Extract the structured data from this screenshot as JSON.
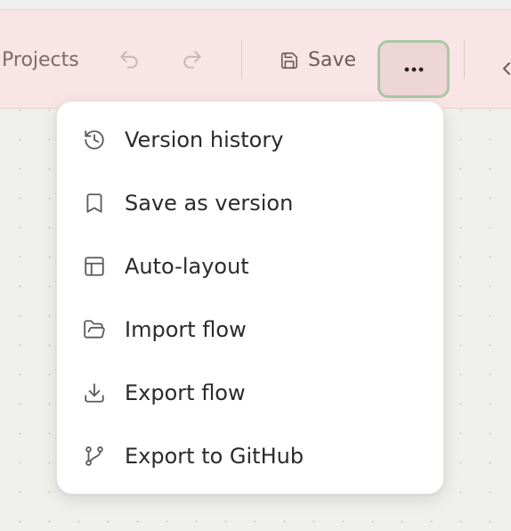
{
  "toolbar": {
    "projects_label": "Projects",
    "save_label": "Save",
    "undo_icon": "undo-icon",
    "redo_icon": "redo-icon",
    "more_icon": "more-horizontal-icon",
    "accent_focus_color": "#a9c8a4",
    "background_color": "#f9e5e6"
  },
  "menu": {
    "items": [
      {
        "label": "Version history",
        "icon": "history-icon"
      },
      {
        "label": "Save as version",
        "icon": "bookmark-icon"
      },
      {
        "label": "Auto-layout",
        "icon": "layout-icon"
      },
      {
        "label": "Import flow",
        "icon": "folder-open-icon"
      },
      {
        "label": "Export flow",
        "icon": "download-icon"
      },
      {
        "label": "Export to GitHub",
        "icon": "git-branch-icon"
      }
    ]
  }
}
